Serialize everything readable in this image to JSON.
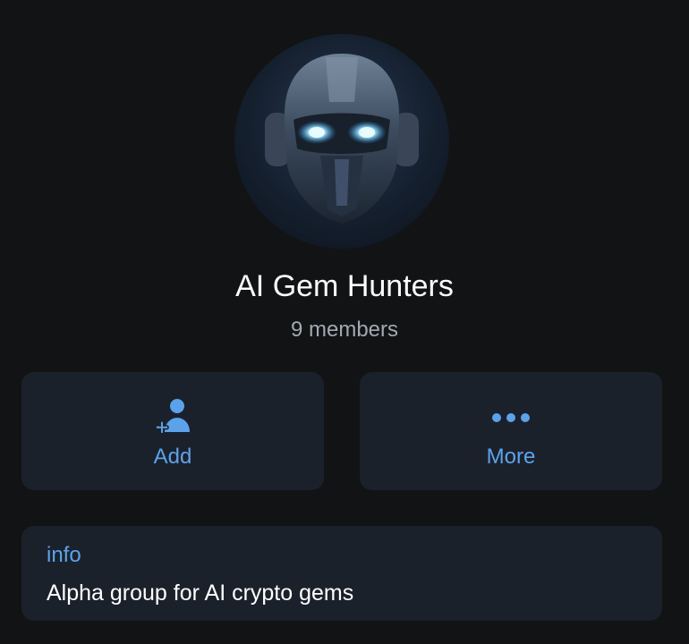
{
  "group": {
    "name": "AI Gem Hunters",
    "members": "9 members"
  },
  "actions": {
    "add_label": "Add",
    "more_label": "More"
  },
  "info": {
    "label": "info",
    "description": "Alpha group for AI crypto gems"
  },
  "colors": {
    "background": "#121314",
    "card": "#1b212b",
    "accent": "#5aa3ec",
    "title": "#ffffff",
    "subtitle": "#a2a9b2"
  },
  "icons": {
    "add": "add-member-icon",
    "more": "more-dots-icon",
    "avatar": "robot-helmet-avatar"
  }
}
